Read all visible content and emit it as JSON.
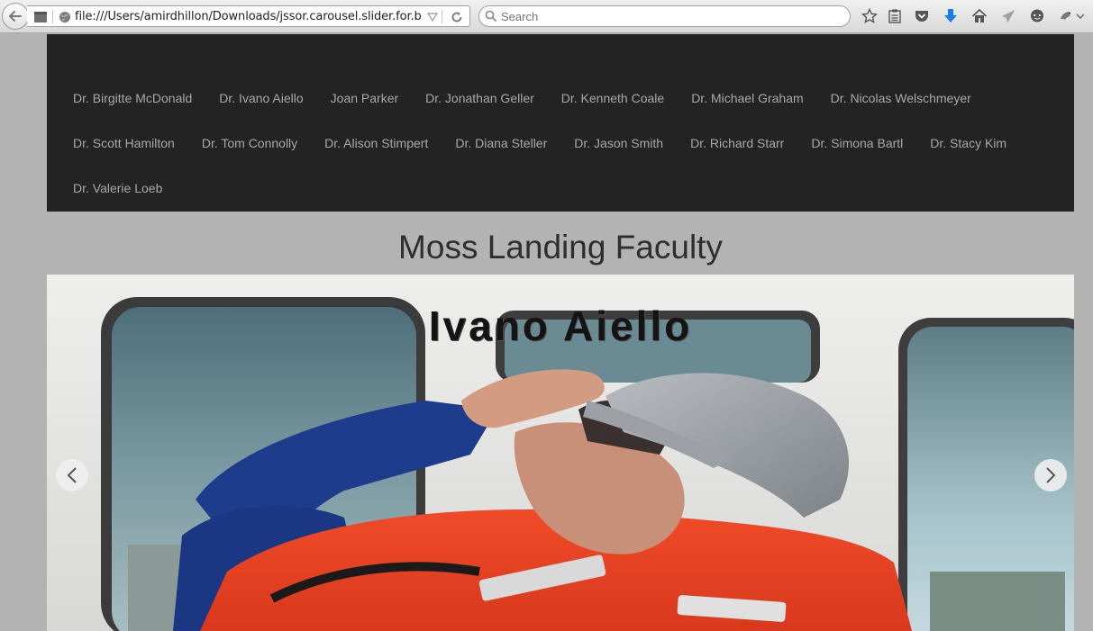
{
  "browser": {
    "url": "file:///Users/amirdhillon/Downloads/jssor.carousel.slider.for.boo",
    "search_placeholder": "Search",
    "icons": [
      "back-icon",
      "page-icon",
      "globe-icon",
      "dropdown-icon",
      "reload-icon",
      "search-icon",
      "bookmark-star-icon",
      "reading-list-icon",
      "pocket-icon",
      "downloads-icon",
      "home-icon",
      "share-icon",
      "chat-icon",
      "extension-icon",
      "menu-chevron-icon"
    ]
  },
  "nav": {
    "rows": [
      [
        "Dr. Birgitte McDonald",
        "Dr. Ivano Aiello",
        "Joan Parker",
        "Dr. Jonathan Geller",
        "Dr. Kenneth Coale",
        "Dr. Michael Graham",
        "Dr. Nicolas Welschmeyer"
      ],
      [
        "Dr. Scott Hamilton",
        "Dr. Tom Connolly",
        "Dr. Alison Stimpert",
        "Dr. Diana Steller",
        "Dr. Jason Smith",
        "Dr. Richard Starr",
        "Dr. Simona Bartl",
        "Dr. Stacy Kim"
      ],
      [
        "Dr. Valerie Loeb"
      ]
    ]
  },
  "page": {
    "title": "Moss Landing Faculty"
  },
  "slider": {
    "current_slide_label": "Ivano Aiello",
    "prev_icon": "chevron-left-icon",
    "next_icon": "chevron-right-icon"
  },
  "colors": {
    "page_bg": "#b3b3b3",
    "navbar_bg": "#232323",
    "nav_link": "#a8a8a8",
    "title": "#2e2e2e"
  }
}
